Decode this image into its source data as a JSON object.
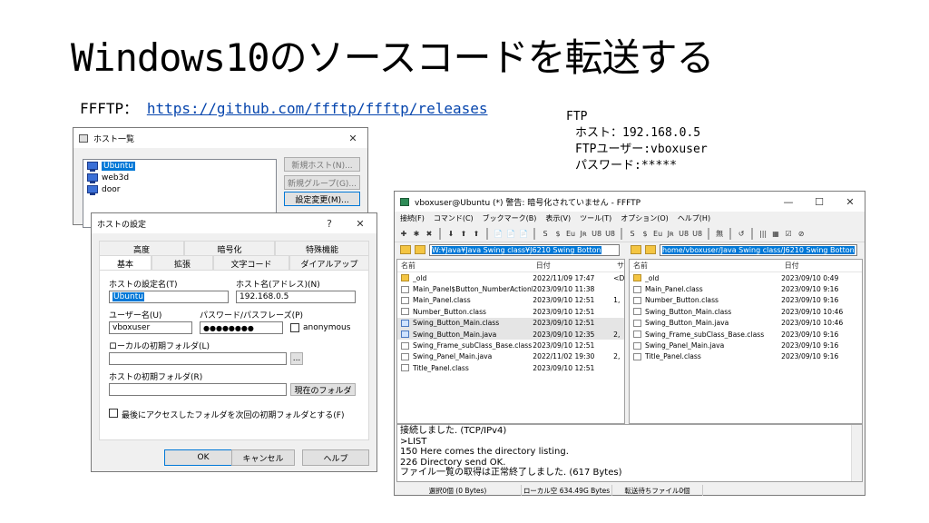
{
  "slide": {
    "title": "Windows10のソースコードを転送する",
    "ffftp_label": "FFFTP：",
    "ffftp_url": "https://github.com/ffftp/ffftp/releases",
    "notes": [
      "FTP",
      "ホスト：192.168.0.5",
      "FTPユーザー:vboxuser",
      "パスワード:*****"
    ]
  },
  "host_list_window": {
    "title": "ホスト一覧",
    "close_glyph": "✕",
    "hosts": [
      "Ubuntu",
      "web3d",
      "door"
    ],
    "buttons": [
      "新規ホスト(N)...",
      "新規グループ(G)...",
      "設定変更(M)..."
    ]
  },
  "host_settings_dialog": {
    "title": "ホストの設定",
    "help_glyph": "?",
    "close_glyph": "✕",
    "tabs_top": [
      "高度",
      "暗号化",
      "特殊機能"
    ],
    "tabs_bottom": [
      "基本",
      "拡張",
      "文字コード",
      "ダイアルアップ"
    ],
    "host_setting_name_label": "ホストの設定名(T)",
    "host_setting_name_value": "Ubuntu",
    "host_name_label": "ホスト名(アドレス)(N)",
    "host_name_value": "192.168.0.5",
    "user_name_label": "ユーザー名(U)",
    "user_name_value": "vboxuser",
    "password_label": "パスワード/パスフレーズ(P)",
    "password_value": "●●●●●●●●",
    "anonymous_label": "anonymous",
    "local_folder_label": "ローカルの初期フォルダ(L)",
    "local_folder_value": "",
    "browse_label": "...",
    "host_folder_label": "ホストの初期フォルダ(R)",
    "host_folder_value": "",
    "current_folder_button": "現在のフォルダ",
    "last_folder_checkbox_label": "最後にアクセスしたフォルダを次回の初期フォルダとする(F)",
    "ok_button": "OK",
    "cancel_button": "キャンセル",
    "help_button": "ヘルプ"
  },
  "ffftp_window": {
    "title": "vboxuser@Ubuntu (*) 警告: 暗号化されていません - FFFTP",
    "min_glyph": "—",
    "max_glyph": "☐",
    "close_glyph": "✕",
    "menu": [
      "接続(F)",
      "コマンド(C)",
      "ブックマーク(B)",
      "表示(V)",
      "ツール(T)",
      "オプション(O)",
      "ヘルプ(H)"
    ],
    "toolbar": [
      "✚",
      "✱",
      "✖",
      "⬇",
      "⬆",
      "⬆",
      "📄",
      "📄",
      "📄",
      "S",
      "$",
      "Eu",
      "Jʀ",
      "U8",
      "U8",
      "S",
      "$",
      "Eu",
      "Jʀ",
      "U8",
      "U8",
      "無",
      "↺",
      "|||",
      "▦",
      "☑",
      "⊘"
    ],
    "local_path": "W:¥Java¥Java Swing class¥J6210 Swing Botton",
    "remote_path": "home/vboxuser/Java Swing class/J6210 Swing Botton",
    "local_columns": [
      "名前",
      "日付",
      "サ"
    ],
    "remote_columns": [
      "名前",
      "日付"
    ],
    "local_files": [
      {
        "name": "_old",
        "date": "2022/11/09 17:47",
        "size": "<D",
        "type": "folder"
      },
      {
        "name": "Main_Panel$Button_NumberActionLi...",
        "date": "2023/09/10 11:38",
        "size": "",
        "type": "file"
      },
      {
        "name": "Main_Panel.class",
        "date": "2023/09/10 12:51",
        "size": "1,",
        "type": "file"
      },
      {
        "name": "Number_Button.class",
        "date": "2023/09/10 12:51",
        "size": "",
        "type": "file"
      },
      {
        "name": "Swing_Button_Main.class",
        "date": "2023/09/10 12:51",
        "size": "",
        "type": "java"
      },
      {
        "name": "Swing_Button_Main.java",
        "date": "2023/09/10 12:35",
        "size": "2,",
        "type": "java"
      },
      {
        "name": "Swing_Frame_subClass_Base.class",
        "date": "2023/09/10 12:51",
        "size": "",
        "type": "file"
      },
      {
        "name": "Swing_Panel_Main.java",
        "date": "2022/11/02 19:30",
        "size": "2,",
        "type": "file"
      },
      {
        "name": "Title_Panel.class",
        "date": "2023/09/10 12:51",
        "size": "",
        "type": "file"
      }
    ],
    "remote_files": [
      {
        "name": "_old",
        "date": "2023/09/10 0:49",
        "type": "folder"
      },
      {
        "name": "Main_Panel.class",
        "date": "2023/09/10 9:16",
        "type": "file"
      },
      {
        "name": "Number_Button.class",
        "date": "2023/09/10 9:16",
        "type": "file"
      },
      {
        "name": "Swing_Button_Main.class",
        "date": "2023/09/10 10:46",
        "type": "file"
      },
      {
        "name": "Swing_Button_Main.java",
        "date": "2023/09/10 10:46",
        "type": "file"
      },
      {
        "name": "Swing_Frame_subClass_Base.class",
        "date": "2023/09/10 9:16",
        "type": "file"
      },
      {
        "name": "Swing_Panel_Main.java",
        "date": "2023/09/10 9:16",
        "type": "file"
      },
      {
        "name": "Title_Panel.class",
        "date": "2023/09/10 9:16",
        "type": "file"
      }
    ],
    "log_lines": [
      "接続しました. (TCP/IPv4)",
      ">LIST",
      "150 Here comes the directory listing.",
      "226 Directory send OK.",
      "ファイル一覧の取得は正常終了しました. (617 Bytes)"
    ],
    "status": [
      "選択0個 (0 Bytes)",
      "ローカル空 634.49G Bytes",
      "転送待ちファイル0個"
    ]
  }
}
